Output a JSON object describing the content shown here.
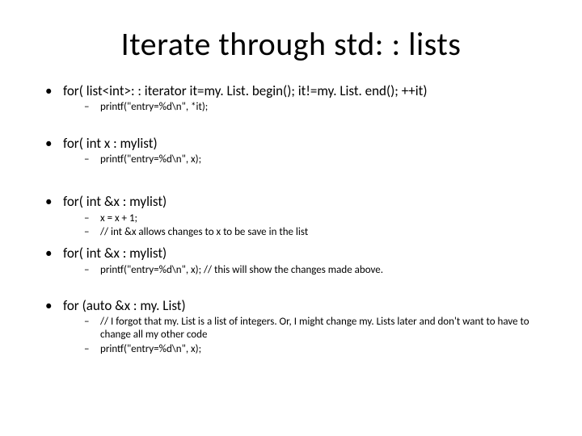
{
  "title": "Iterate through std: : lists",
  "items": [
    {
      "text": "for( list<int>: : iterator it=my. List. begin(); it!=my. List. end(); ++it)",
      "subs": [
        "printf(\"entry=%d\\n\", *it);"
      ],
      "gapAfter": "large"
    },
    {
      "text": "for( int x : mylist)",
      "subs": [
        "printf(\"entry=%d\\n\", x);"
      ],
      "gapAfter": "med"
    },
    {
      "text": "for( int &x : mylist)",
      "subs": [
        "x = x + 1;",
        "// int &x allows changes to x to be save in the list"
      ],
      "gapAfter": "small"
    },
    {
      "text": "for( int &x : mylist)",
      "subs": [
        "printf(\"entry=%d\\n\", x);   // this will show the changes made above."
      ],
      "gapAfter": "large"
    },
    {
      "text": "for (auto &x : my. List)",
      "subs": [
        "// I forgot that my. List is a list of integers. Or, I might change my. Lists later and don't want to have to change all my other code",
        "printf(\"entry=%d\\n\", x);"
      ],
      "gapAfter": "none"
    }
  ]
}
